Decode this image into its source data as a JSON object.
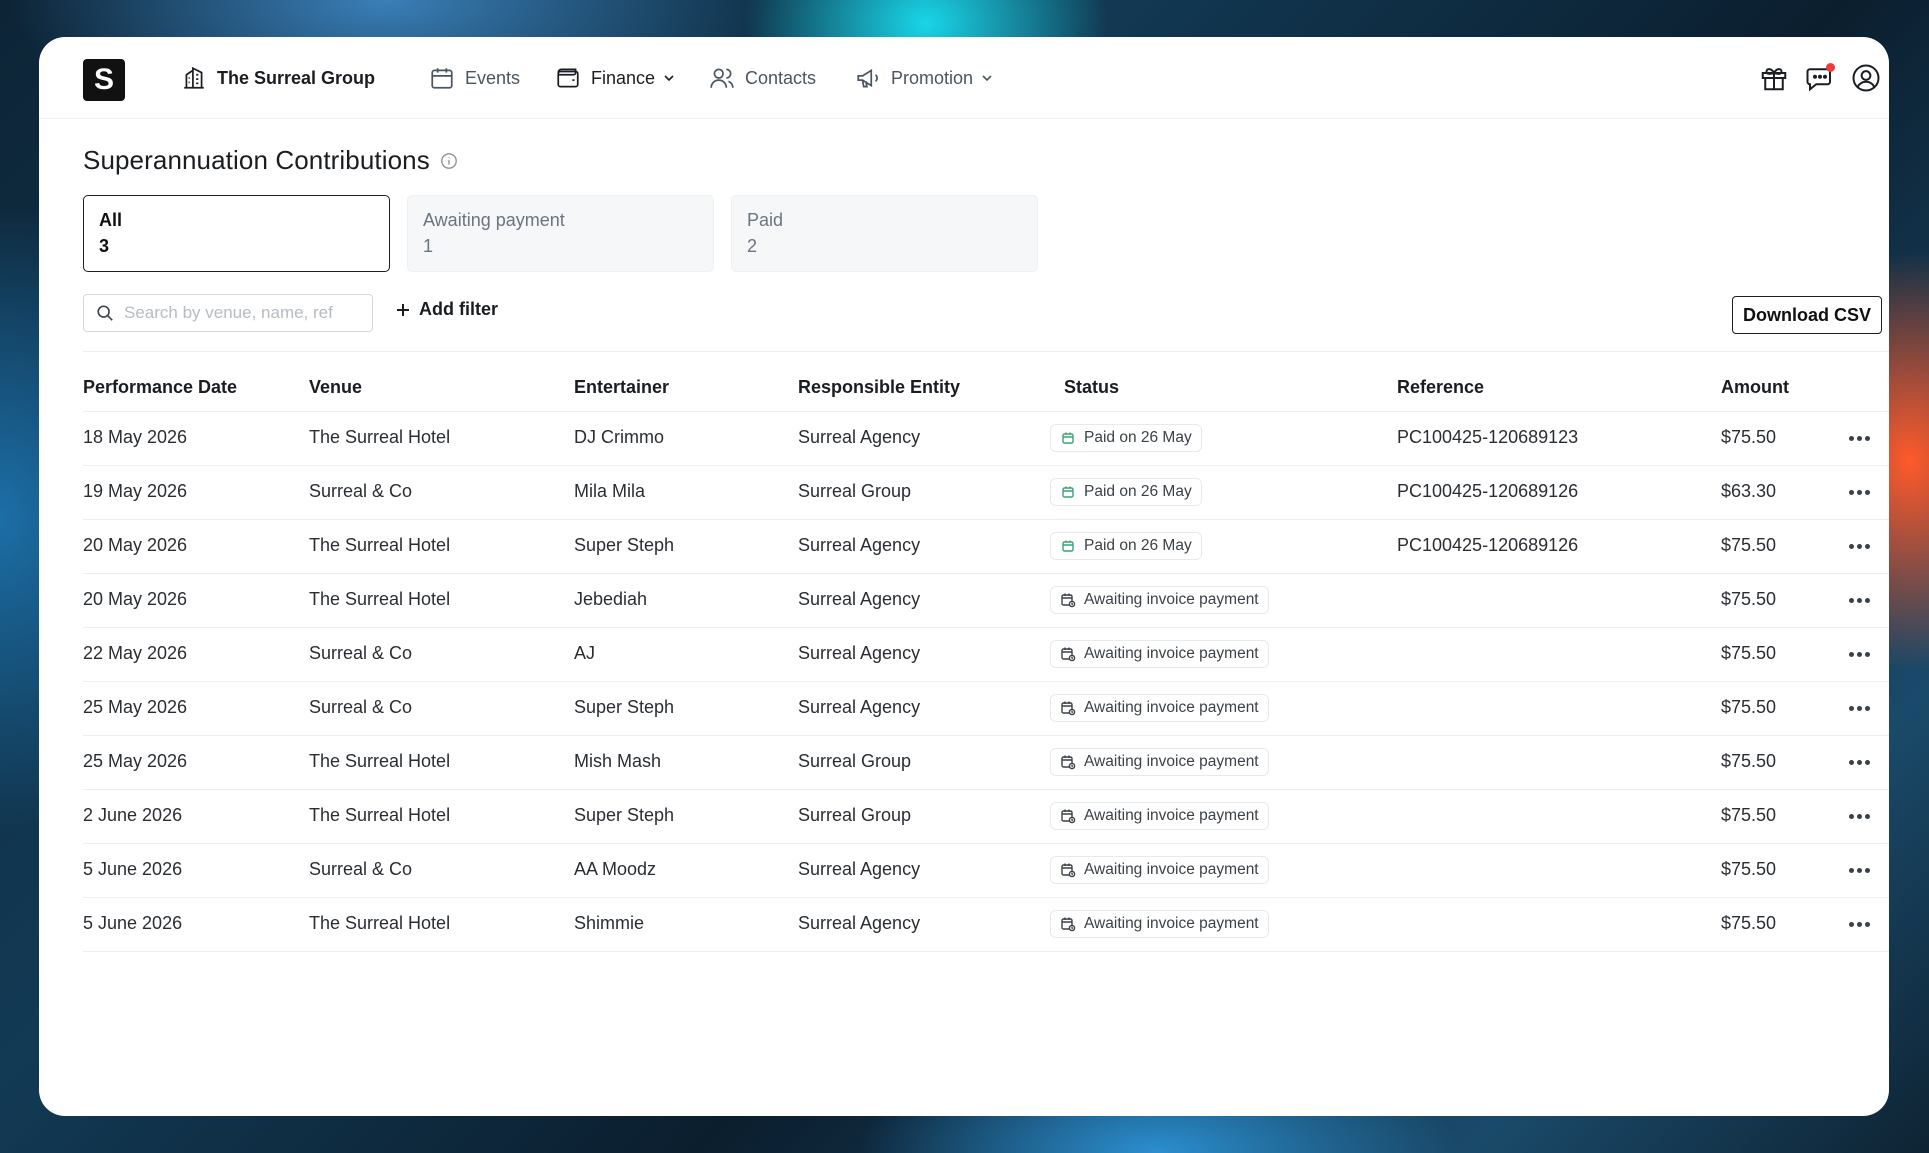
{
  "brand": {
    "logo_letter": "S",
    "org_name": "The Surreal Group"
  },
  "nav": {
    "events": "Events",
    "finance": "Finance",
    "contacts": "Contacts",
    "promotion": "Promotion"
  },
  "page": {
    "title": "Superannuation Contributions"
  },
  "tabs": [
    {
      "label": "All",
      "count": "3"
    },
    {
      "label": "Awaiting payment",
      "count": "1"
    },
    {
      "label": "Paid",
      "count": "2"
    }
  ],
  "toolbar": {
    "search_placeholder": "Search by venue, name, ref",
    "add_filter": "Add filter",
    "download": "Download CSV"
  },
  "table": {
    "headers": {
      "date": "Performance Date",
      "venue": "Venue",
      "entertainer": "Entertainer",
      "entity": "Responsible Entity",
      "status": "Status",
      "reference": "Reference",
      "amount": "Amount"
    },
    "rows": [
      {
        "date": "18 May 2026",
        "venue": "The Surreal Hotel",
        "entertainer": "DJ Crimmo",
        "entity": "Surreal Agency",
        "status": "Paid on 26 May",
        "status_type": "paid",
        "reference": "PC100425-120689123",
        "amount": "$75.50"
      },
      {
        "date": "19 May 2026",
        "venue": "Surreal & Co",
        "entertainer": "Mila Mila",
        "entity": "Surreal Group",
        "status": "Paid on 26 May",
        "status_type": "paid",
        "reference": "PC100425-120689126",
        "amount": "$63.30"
      },
      {
        "date": "20 May 2026",
        "venue": "The Surreal Hotel",
        "entertainer": "Super Steph",
        "entity": "Surreal Agency",
        "status": "Paid on 26 May",
        "status_type": "paid",
        "reference": "PC100425-120689126",
        "amount": "$75.50"
      },
      {
        "date": "20 May 2026",
        "venue": "The Surreal Hotel",
        "entertainer": "Jebediah",
        "entity": "Surreal Agency",
        "status": "Awaiting invoice payment",
        "status_type": "awaiting",
        "reference": "",
        "amount": "$75.50"
      },
      {
        "date": "22 May 2026",
        "venue": "Surreal & Co",
        "entertainer": "AJ",
        "entity": "Surreal Agency",
        "status": "Awaiting invoice payment",
        "status_type": "awaiting",
        "reference": "",
        "amount": "$75.50"
      },
      {
        "date": "25 May 2026",
        "venue": "Surreal & Co",
        "entertainer": "Super Steph",
        "entity": "Surreal Agency",
        "status": "Awaiting invoice payment",
        "status_type": "awaiting",
        "reference": "",
        "amount": "$75.50"
      },
      {
        "date": "25 May 2026",
        "venue": "The Surreal Hotel",
        "entertainer": "Mish Mash",
        "entity": "Surreal Group",
        "status": "Awaiting invoice payment",
        "status_type": "awaiting",
        "reference": "",
        "amount": "$75.50"
      },
      {
        "date": "2 June 2026",
        "venue": "The Surreal Hotel",
        "entertainer": "Super Steph",
        "entity": "Surreal Group",
        "status": "Awaiting invoice payment",
        "status_type": "awaiting",
        "reference": "",
        "amount": "$75.50"
      },
      {
        "date": "5 June 2026",
        "venue": "Surreal & Co",
        "entertainer": "AA Moodz",
        "entity": "Surreal Agency",
        "status": "Awaiting invoice payment",
        "status_type": "awaiting",
        "reference": "",
        "amount": "$75.50"
      },
      {
        "date": "5 June 2026",
        "venue": "The Surreal Hotel",
        "entertainer": "Shimmie",
        "entity": "Surreal Agency",
        "status": "Awaiting invoice payment",
        "status_type": "awaiting",
        "reference": "",
        "amount": "$75.50"
      }
    ]
  },
  "colors": {
    "paid_icon": "#3aa374",
    "notification_dot": "#ef3b3b",
    "text_primary": "#1a1d21"
  }
}
